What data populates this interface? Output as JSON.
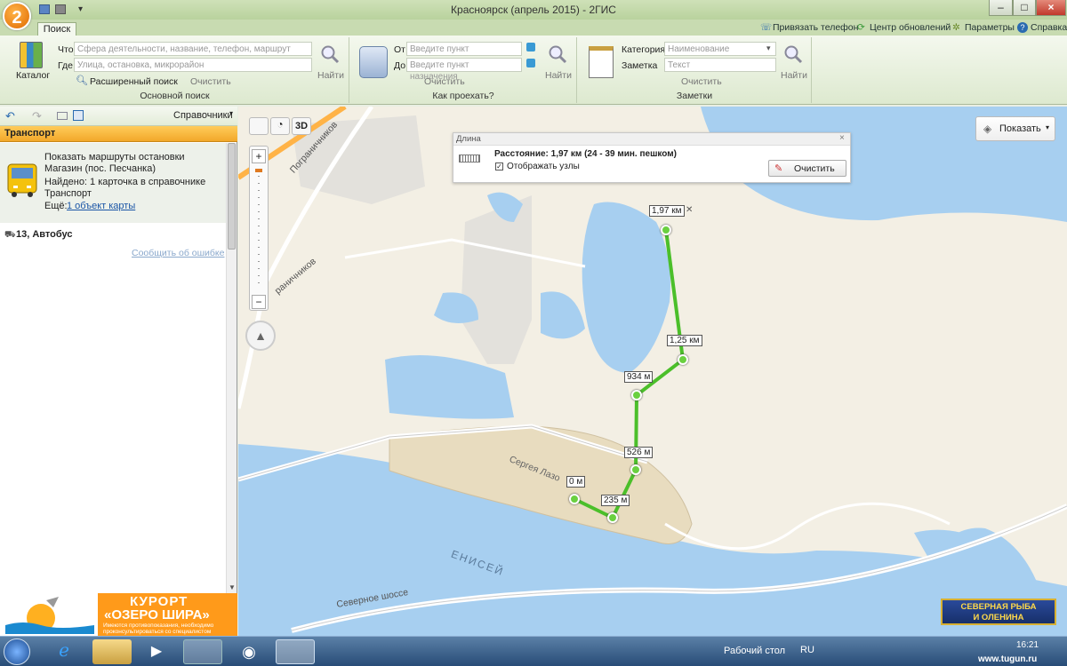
{
  "window": {
    "title": "Красноярск (апрель 2015) - 2ГИС",
    "minimize": "–",
    "maximize": "□",
    "close": "×",
    "logo": "2"
  },
  "ribbon": {
    "tab_search": "Поиск",
    "top_links": [
      "Привязать телефон",
      "Центр обновлений",
      "Параметры",
      "Справка"
    ],
    "main_search": {
      "catalog_label": "Каталог",
      "what_label": "Что",
      "what_placeholder": "Сфера деятельности, название, телефон, маршрут",
      "where_label": "Где",
      "where_placeholder": "Улица, остановка, микрорайон",
      "advanced_label": "Расширенный поиск",
      "clear_label": "Очистить",
      "find_label": "Найти",
      "group_label": "Основной поиск"
    },
    "route": {
      "from_label": "От",
      "from_placeholder": "Введите пункт отправления",
      "to_label": "До",
      "to_placeholder": "Введите пункт назначения",
      "clear_label": "Очистить",
      "find_label": "Найти",
      "group_label": "Как проехать?"
    },
    "notes": {
      "category_label": "Категория",
      "category_placeholder": "Наименование",
      "note_label": "Заметка",
      "note_placeholder": "Текст",
      "clear_label": "Очистить",
      "find_label": "Найти",
      "group_label": "Заметки"
    }
  },
  "left_pane": {
    "toolbar_dropdown": "Справочники",
    "header": "Транспорт",
    "card_title": "Показать маршруты остановки Магазин (пос. Песчанка)",
    "card_found": "Найдено: 1 карточка в справочнике Транспорт",
    "card_more_label": "Ещё:",
    "card_more_link": "1 объект карты",
    "route_item": "13, Автобус",
    "report_error": "Сообщить об ошибке",
    "banner_title1": "КУРОРТ",
    "banner_title2": "«ОЗЕРО ШИРА»",
    "banner_small1": "Имеются противопоказания, необходимо",
    "banner_small2": "проконсультироваться со специалистом"
  },
  "map": {
    "btn_3d": "3D",
    "zoom_in": "+",
    "zoom_out": "−",
    "show_button": "Показать",
    "measure": {
      "title": "Длина",
      "distance": "Расстояние: 1,97 км (24 - 39 мин. пешком)",
      "show_nodes": "Отображать узлы",
      "clear": "Очистить"
    },
    "route_labels": [
      "0 м",
      "235 м",
      "526 м",
      "934 м",
      "1,25 км",
      "1,97 км"
    ],
    "street_labels": [
      "Сергея Лазо",
      "ЕНИСЕЙ",
      "Северное шоссе",
      "Пограничников",
      "раничников"
    ],
    "ad_line1": "СЕВЕРНАЯ РЫБА",
    "ad_line2": "И ОЛЕНИНА"
  },
  "taskbar": {
    "desktop_label": "Рабочий стол",
    "lang": "RU",
    "time": "16:21",
    "watermark": "www.tugun.ru"
  }
}
